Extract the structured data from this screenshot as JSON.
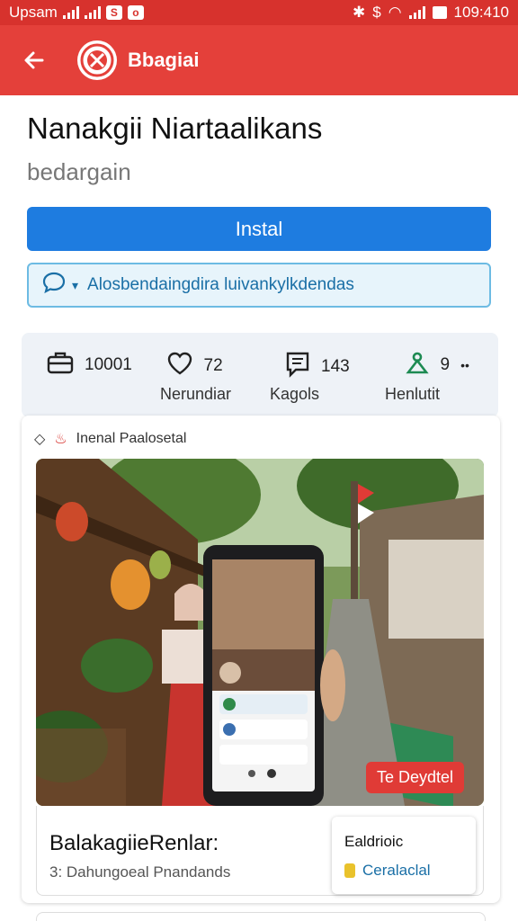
{
  "status": {
    "carrier": "Upsam",
    "time": "109:410"
  },
  "appbar": {
    "title": "Bbagiai"
  },
  "header": {
    "title": "Nanakgii Niartaalikans",
    "subtitle": "bedargain"
  },
  "actions": {
    "install_label": "Instal",
    "promo_text": "Alosbendaingdira luivankylkdendas"
  },
  "stats": [
    {
      "value": "10001",
      "label": "Nerundiar",
      "icon": "briefcase-icon"
    },
    {
      "value": "72",
      "label": "Kagols",
      "icon": "heart-icon"
    },
    {
      "value": "143",
      "label": "Henlutit",
      "icon": "message-icon"
    },
    {
      "value": "9",
      "label": "",
      "icon": "person-icon"
    }
  ],
  "feature": {
    "header": "Inenal Paalosetal",
    "badge": "Te Deydtel",
    "title": "BalakagiieRenlar:",
    "subtitle": "3: Dahungoeal Pnandands",
    "mini_title": "Ealdrioic",
    "mini_link": "Ceralaclal"
  },
  "colors": {
    "primary": "#e4403a",
    "install": "#1e7ce0",
    "promo_bg": "#e7f4fb",
    "link": "#1a6fa6"
  }
}
